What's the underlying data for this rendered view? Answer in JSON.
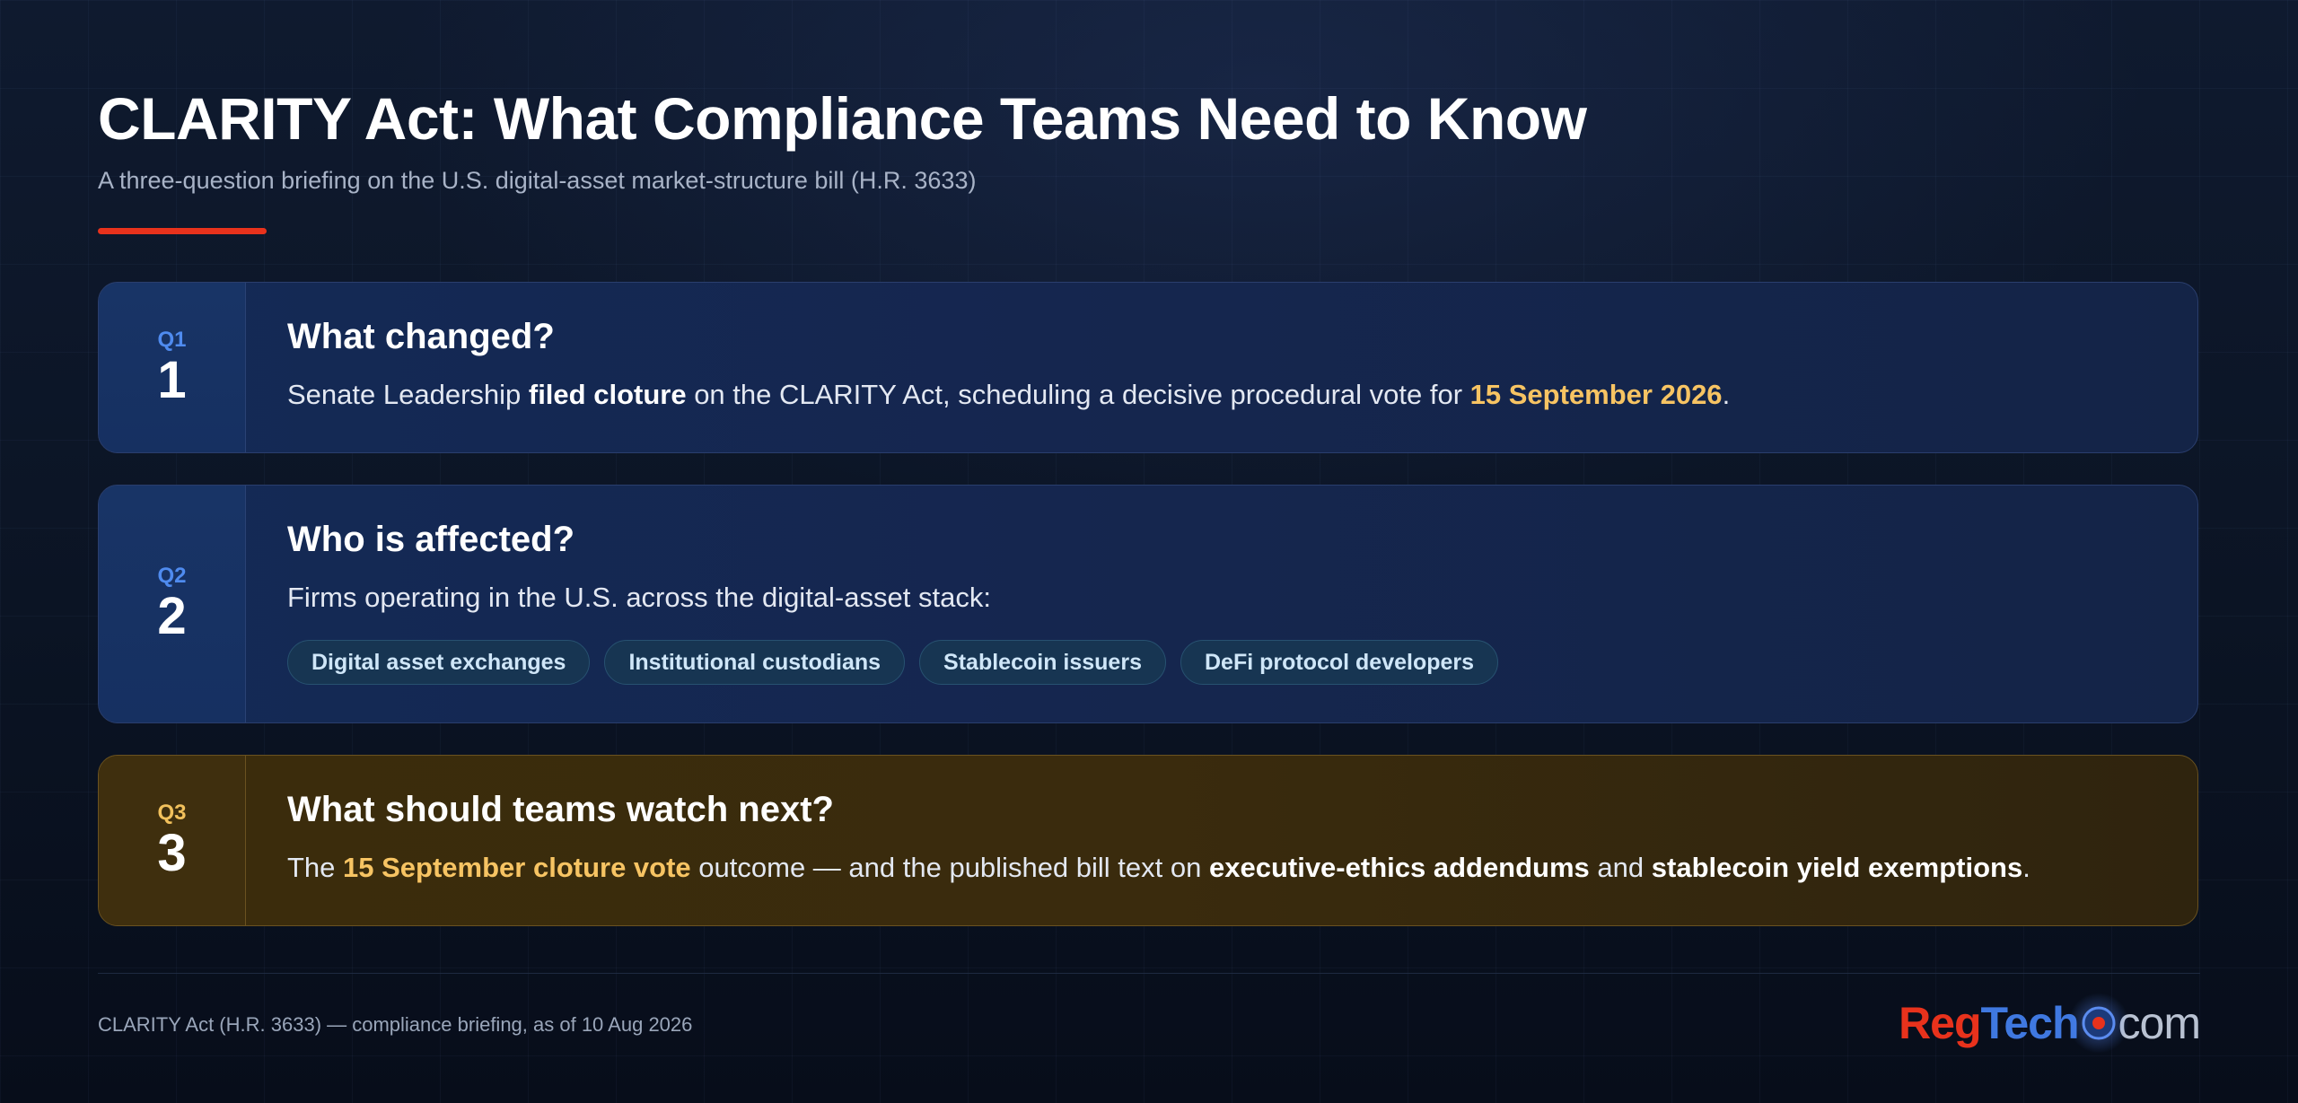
{
  "header": {
    "title": "CLARITY Act: What Compliance Teams Need to Know",
    "subtitle": "A three-question briefing on the U.S. digital-asset market-structure bill (H.R. 3633)"
  },
  "cards": [
    {
      "q_label": "Q1",
      "q_number": "1",
      "heading": "What changed?",
      "text": {
        "t1": "Senate Leadership ",
        "b1": "filed cloture",
        "t2": " on the CLARITY Act, scheduling a decisive procedural vote for ",
        "hl1": "15 September 2026",
        "t3": "."
      }
    },
    {
      "q_label": "Q2",
      "q_number": "2",
      "heading": "Who is affected?",
      "text": "Firms operating in the U.S. across the digital-asset stack:",
      "tags": [
        "Digital asset exchanges",
        "Institutional custodians",
        "Stablecoin issuers",
        "DeFi protocol developers"
      ]
    },
    {
      "q_label": "Q3",
      "q_number": "3",
      "heading": "What should teams watch next?",
      "text": {
        "t1": "The ",
        "hl1": "15 September cloture vote",
        "t2": " outcome — and the published bill text on ",
        "b1": "executive-ethics addendums",
        "t3": " and ",
        "b2": "stablecoin yield exemptions",
        "t4": "."
      }
    }
  ],
  "footer": {
    "text": "CLARITY Act (H.R. 3633) — compliance briefing, as of 10 Aug 2026",
    "logo": {
      "part1": "Reg",
      "part2": "Tech",
      "part3": "com"
    }
  },
  "colors": {
    "accent_red": "#e8321c",
    "highlight_gold": "#f7c463",
    "q_blue": "#4f8bef",
    "q_gold": "#f2c15c",
    "logo_blue": "#3f78e0"
  }
}
